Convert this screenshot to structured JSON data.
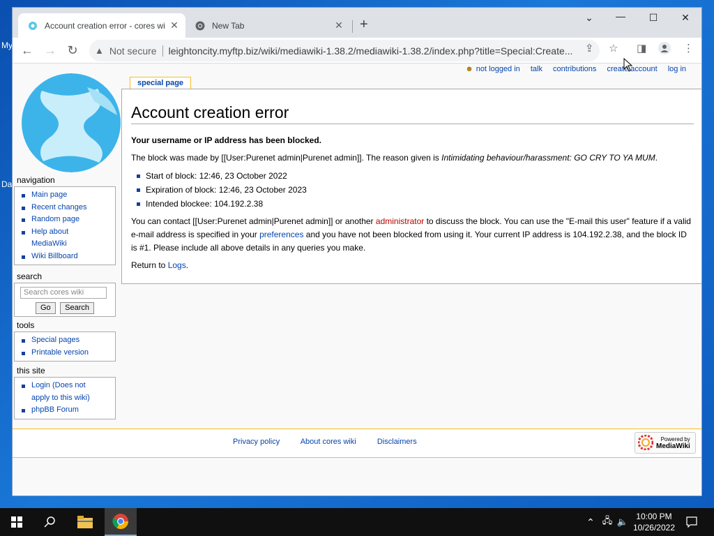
{
  "desktop": {
    "labels": [
      "My",
      "Da"
    ]
  },
  "browser": {
    "tabs": [
      {
        "title": "Account creation error - cores wi",
        "active": true
      },
      {
        "title": "New Tab",
        "active": false
      }
    ],
    "security": "Not secure",
    "url": "leightoncity.myftp.biz/wiki/mediawiki-1.38.2/mediawiki-1.38.2/index.php?title=Special:Create..."
  },
  "wiki": {
    "personal_tools": {
      "user": "not logged in",
      "talk": "talk",
      "contributions": "contributions",
      "create_account": "create account",
      "log_in": "log in"
    },
    "page_tab": "special page",
    "title": "Account creation error",
    "blocked_msg": "Your username or IP address has been blocked.",
    "block_made_prefix": "The block was made by [[User:Purenet admin|Purenet admin]]. The reason given is ",
    "block_reason": "Intimidating behaviour/harassment: GO CRY TO YA MUM",
    "block_made_suffix": ".",
    "details": [
      "Start of block: 12:46, 23 October 2022",
      "Expiration of block: 12:46, 23 October 2023",
      "Intended blockee: 104.192.2.38"
    ],
    "contact_1": "You can contact [[User:Purenet admin|Purenet admin]] or another ",
    "contact_admin": "administrator",
    "contact_2": " to discuss the block. You can use the \"E-mail this user\" feature if a valid e-mail address is specified in your ",
    "contact_prefs": "preferences",
    "contact_3": " and you have not been blocked from using it. Your current IP address is 104.192.2.38, and the block ID is #1. Please include all above details in any queries you make.",
    "return_prefix": "Return to ",
    "return_link": "Logs",
    "return_suffix": ".",
    "navigation": {
      "heading": "navigation",
      "items": [
        "Main page",
        "Recent changes",
        "Random page",
        "Help about",
        "MediaWiki",
        "Wiki Billboard"
      ]
    },
    "search": {
      "heading": "search",
      "placeholder": "Search cores wiki",
      "go": "Go",
      "search": "Search"
    },
    "tools": {
      "heading": "tools",
      "items": [
        "Special pages",
        "Printable version"
      ]
    },
    "this_site": {
      "heading": "this site",
      "items": [
        "Login (Does not",
        "apply to this wiki)",
        "phpBB Forum"
      ]
    },
    "footer": {
      "links": [
        "Privacy policy",
        "About cores wiki",
        "Disclaimers"
      ],
      "powered_1": "Powered by",
      "powered_2": "MediaWiki"
    }
  },
  "taskbar": {
    "time": "10:00 PM",
    "date": "10/26/2022"
  }
}
